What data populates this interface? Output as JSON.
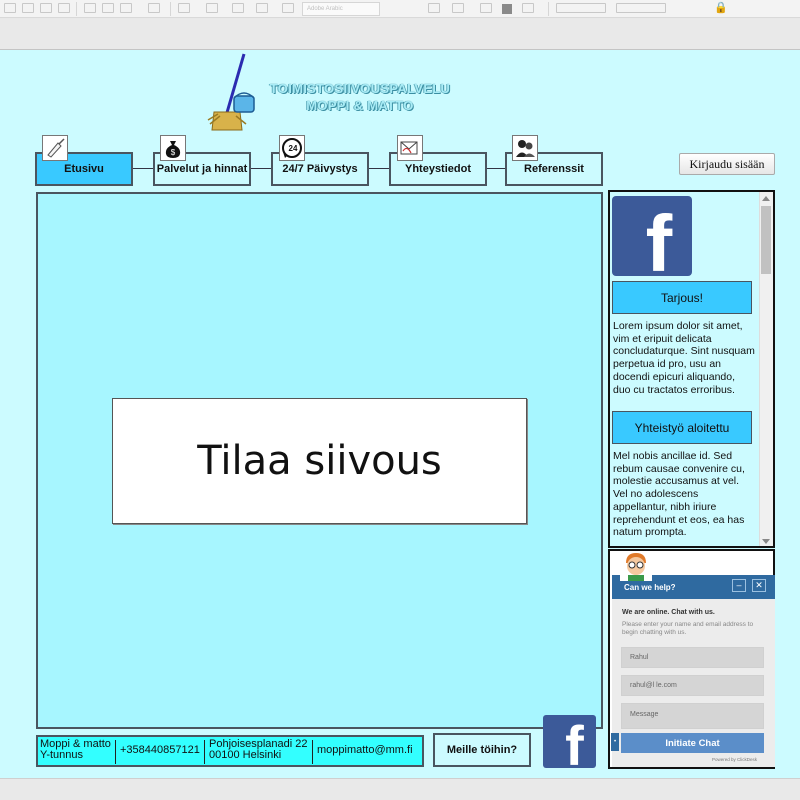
{
  "toolbar": {
    "font_placeholder": "Adobe Arabic",
    "lock_icon": "lock-icon",
    "swatch_color": "#8a8a8a"
  },
  "header": {
    "title_line1": "TOIMISTOSIIVOUSPALVELU",
    "title_line2": "MOPPI & MATTO",
    "logo_icon": "mop-bucket-icon"
  },
  "nav": {
    "items": [
      {
        "label": "Etusivu",
        "icon": "broom-icon",
        "active": true
      },
      {
        "label": "Palvelut ja hinnat",
        "icon": "money-bag-icon",
        "active": false
      },
      {
        "label": "24/7 Päivystys",
        "icon": "phone-24-icon",
        "active": false
      },
      {
        "label": "Yhteystiedot",
        "icon": "contact-icon",
        "active": false
      },
      {
        "label": "Referenssit",
        "icon": "people-icon",
        "active": false
      }
    ],
    "login_label": "Kirjaudu sisään"
  },
  "main": {
    "cta_label": "Tilaa siivous"
  },
  "side": {
    "facebook_icon": "facebook-icon",
    "offer_button": "Tarjous!",
    "offer_text": "Lorem ipsum dolor sit amet, vim et eripuit delicata concludaturque. Sint nusquam perpetua id pro, usu an docendi epicuri aliquando, duo cu tractatos erroribus.",
    "coop_button": "Yhteistyö aloitettu",
    "coop_text": "Mel nobis ancillae id. Sed rebum causae convenire cu, molestie accusamus at vel. Vel no adolescens appellantur, nibh iriure reprehendunt et eos, ea has natum prompta."
  },
  "chat": {
    "title": "Can we help?",
    "minimize": "–",
    "close": "✕",
    "online_text": "We are online. Chat with us.",
    "hint_text": "Please enter your name and email address to begin chatting with us.",
    "name_value": "Rahul",
    "email_value": "rahul@l            le.com",
    "message_placeholder": "Message",
    "submit_label": "Initiate Chat",
    "powered_by": "Powered by ClickDesk"
  },
  "footer": {
    "company_line1": "Moppi & matto",
    "company_line2": "Y-tunnus",
    "phone": "+358440857121",
    "address_line1": "Pohjoisesplanadi 22",
    "address_line2": "00100 Helsinki",
    "email": "moppimatto@mm.fi",
    "jobs_button": "Meille töihin?"
  },
  "colors": {
    "page_background": "#ccfbff",
    "main_panel": "#a7f6ff",
    "accent": "#39c9ff",
    "footer": "#33ffff",
    "facebook": "#3c5a99",
    "chat_header": "#2f6aa0"
  }
}
